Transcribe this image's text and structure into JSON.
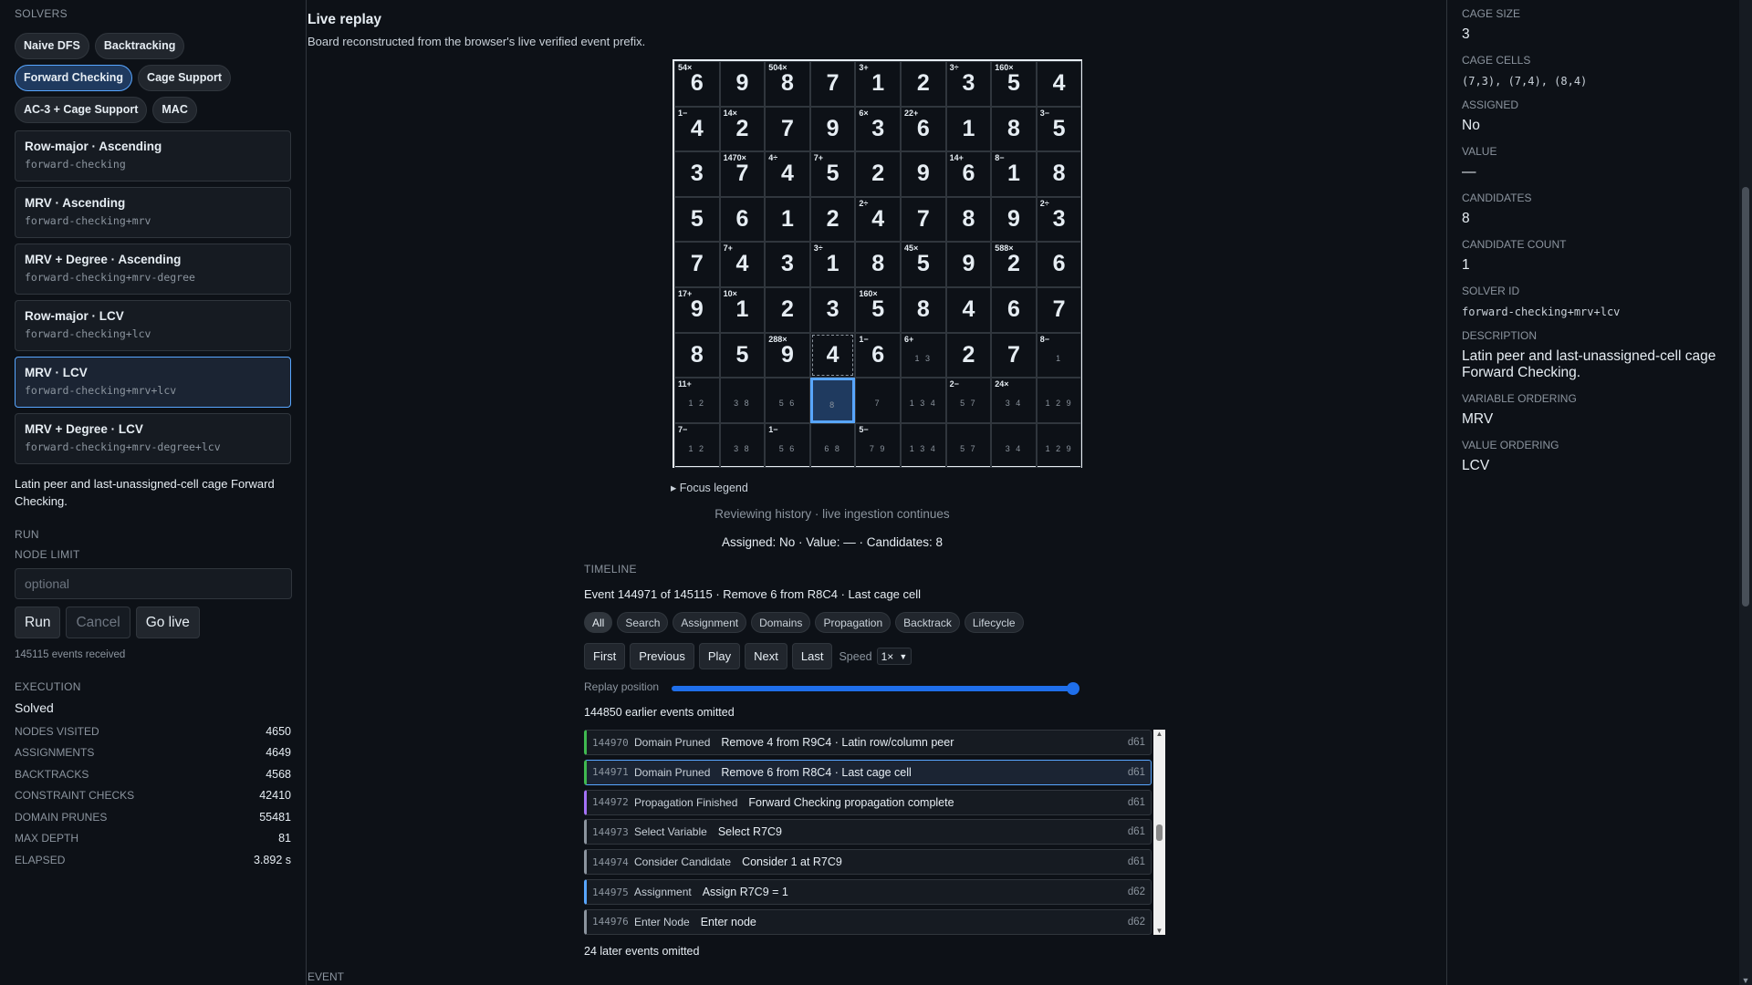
{
  "left": {
    "solvers_heading": "SOLVERS",
    "solver_pills": [
      "Naive DFS",
      "Backtracking",
      "Forward Checking",
      "Cage Support",
      "AC-3 + Cage Support",
      "MAC"
    ],
    "active_pill": "Forward Checking",
    "variants": [
      {
        "title": "Row-major · Ascending",
        "id": "forward-checking"
      },
      {
        "title": "MRV · Ascending",
        "id": "forward-checking+mrv"
      },
      {
        "title": "MRV + Degree · Ascending",
        "id": "forward-checking+mrv-degree"
      },
      {
        "title": "Row-major · LCV",
        "id": "forward-checking+lcv"
      },
      {
        "title": "MRV · LCV",
        "id": "forward-checking+mrv+lcv"
      },
      {
        "title": "MRV + Degree · LCV",
        "id": "forward-checking+mrv-degree+lcv"
      }
    ],
    "description": "Latin peer and last-unassigned-cell cage Forward Checking.",
    "run_heading": "RUN",
    "node_limit_label": "NODE LIMIT",
    "node_limit_placeholder": "optional",
    "run_label": "Run",
    "cancel_label": "Cancel",
    "golive_label": "Go live",
    "events_received": "145115 events received",
    "execution_heading": "EXECUTION",
    "execution_status": "Solved",
    "stats": [
      {
        "k": "NODES VISITED",
        "v": "4650"
      },
      {
        "k": "ASSIGNMENTS",
        "v": "4649"
      },
      {
        "k": "BACKTRACKS",
        "v": "4568"
      },
      {
        "k": "CONSTRAINT CHECKS",
        "v": "42410"
      },
      {
        "k": "DOMAIN PRUNES",
        "v": "55481"
      },
      {
        "k": "MAX DEPTH",
        "v": "81"
      },
      {
        "k": "ELAPSED",
        "v": "3.892 s"
      }
    ]
  },
  "main": {
    "title": "Live replay",
    "subtitle": "Board reconstructed from the browser's live verified event prefix.",
    "board": [
      [
        {
          "c": "54×",
          "v": "6"
        },
        {
          "v": "9"
        },
        {
          "c": "504×",
          "v": "8"
        },
        {
          "v": "7"
        },
        {
          "c": "3+",
          "v": "1"
        },
        {
          "v": "2"
        },
        {
          "c": "3÷",
          "v": "3"
        },
        {
          "c": "160×",
          "v": "5"
        },
        {
          "v": "4"
        }
      ],
      [
        {
          "c": "1−",
          "v": "4"
        },
        {
          "c": "14×",
          "v": "2"
        },
        {
          "v": "7"
        },
        {
          "v": "9"
        },
        {
          "c": "6×",
          "v": "3"
        },
        {
          "c": "22+",
          "v": "6"
        },
        {
          "v": "1"
        },
        {
          "v": "8"
        },
        {
          "c": "3−",
          "v": "5"
        }
      ],
      [
        {
          "v": "3"
        },
        {
          "c": "1470×",
          "v": "7"
        },
        {
          "c": "4÷",
          "v": "4"
        },
        {
          "c": "7+",
          "v": "5"
        },
        {
          "v": "2"
        },
        {
          "v": "9"
        },
        {
          "c": "14+",
          "v": "6"
        },
        {
          "c": "8−",
          "v": "1"
        },
        {
          "v": "8"
        }
      ],
      [
        {
          "v": "5"
        },
        {
          "v": "6"
        },
        {
          "v": "1"
        },
        {
          "v": "2"
        },
        {
          "c": "2÷",
          "v": "4"
        },
        {
          "v": "7"
        },
        {
          "v": "8"
        },
        {
          "v": "9"
        },
        {
          "c": "2÷",
          "v": "3"
        }
      ],
      [
        {
          "v": "7"
        },
        {
          "c": "7+",
          "v": "4"
        },
        {
          "v": "3"
        },
        {
          "c": "3÷",
          "v": "1"
        },
        {
          "v": "8"
        },
        {
          "c": "45×",
          "v": "5"
        },
        {
          "v": "9"
        },
        {
          "c": "588×",
          "v": "2"
        },
        {
          "v": "6"
        }
      ],
      [
        {
          "c": "17+",
          "v": "9"
        },
        {
          "c": "10×",
          "v": "1"
        },
        {
          "v": "2"
        },
        {
          "v": "3"
        },
        {
          "c": "160×",
          "v": "5"
        },
        {
          "v": "8"
        },
        {
          "v": "4"
        },
        {
          "v": "6"
        },
        {
          "v": "7"
        }
      ],
      [
        {
          "v": "8"
        },
        {
          "v": "5"
        },
        {
          "c": "288×",
          "v": "9"
        },
        {
          "v": "4",
          "rel": true
        },
        {
          "c": "1−",
          "v": "6"
        },
        {
          "c": "6+",
          "n": "1 3"
        },
        {
          "v": "2"
        },
        {
          "v": "7"
        },
        {
          "c": "8−",
          "n": "1"
        }
      ],
      [
        {
          "c": "11+",
          "n": "1 2"
        },
        {
          "n": "3 8"
        },
        {
          "n": "5 6"
        },
        {
          "n": "8",
          "sel": true
        },
        {
          "n": "7"
        },
        {
          "n": "1 3 4"
        },
        {
          "c": "2−",
          "n": "5 7"
        },
        {
          "c": "24×",
          "n": "3 4"
        },
        {
          "n": "1 2 9"
        }
      ],
      [
        {
          "c": "7−",
          "n": "1 2"
        },
        {
          "n": "3 8"
        },
        {
          "c": "1−",
          "n": "5 6"
        },
        {
          "n": "6 8"
        },
        {
          "c": "5−",
          "n": "7 9"
        },
        {
          "n": "1 3 4"
        },
        {
          "n": "5 7"
        },
        {
          "n": "3 4"
        },
        {
          "n": "1 2 9"
        }
      ]
    ],
    "focus_legend": "▸ Focus legend",
    "review_status": "Reviewing history · live ingestion continues",
    "cell_status": "Assigned: No · Value: — · Candidates: 8",
    "timeline_heading": "TIMELINE",
    "event_position": "Event 144971 of 145115 · Remove 6 from R8C4 · Last cage cell",
    "filters": [
      "All",
      "Search",
      "Assignment",
      "Domains",
      "Propagation",
      "Backtrack",
      "Lifecycle"
    ],
    "active_filter": "All",
    "controls": [
      "First",
      "Previous",
      "Play",
      "Next",
      "Last"
    ],
    "speed_label": "Speed",
    "speed_value": "1×",
    "replay_label": "Replay position",
    "replay_position": 0.999,
    "earlier_omitted": "144850 earlier events omitted",
    "events": [
      {
        "n": "144970",
        "k": "Domain Pruned",
        "m": "Remove 4 from R9C4 · Latin row/column peer",
        "d": "d61",
        "color": "#3fb950"
      },
      {
        "n": "144971",
        "k": "Domain Pruned",
        "m": "Remove 6 from R8C4 · Last cage cell",
        "d": "d61",
        "color": "#3fb950",
        "active": true
      },
      {
        "n": "144972",
        "k": "Propagation Finished",
        "m": "Forward Checking propagation complete",
        "d": "d61",
        "color": "#a371f7"
      },
      {
        "n": "144973",
        "k": "Select Variable",
        "m": "Select R7C9",
        "d": "d61",
        "color": "#8b949e"
      },
      {
        "n": "144974",
        "k": "Consider Candidate",
        "m": "Consider 1 at R7C9",
        "d": "d61",
        "color": "#8b949e"
      },
      {
        "n": "144975",
        "k": "Assignment",
        "m": "Assign R7C9 = 1",
        "d": "d62",
        "color": "#58a6ff"
      },
      {
        "n": "144976",
        "k": "Enter Node",
        "m": "Enter node",
        "d": "d62",
        "color": "#8b949e"
      }
    ],
    "later_omitted": "24 later events omitted",
    "event_heading": "EVENT"
  },
  "right": {
    "fields": [
      {
        "k": "CAGE SIZE",
        "v": "3"
      },
      {
        "k": "CAGE CELLS",
        "v": "(7,3), (7,4), (8,4)",
        "mono": true
      },
      {
        "k": "ASSIGNED",
        "v": "No"
      },
      {
        "k": "VALUE",
        "v": "—"
      },
      {
        "k": "CANDIDATES",
        "v": "8"
      },
      {
        "k": "CANDIDATE COUNT",
        "v": "1"
      },
      {
        "k": "SOLVER ID",
        "v": "forward-checking+mrv+lcv",
        "mono": true
      },
      {
        "k": "DESCRIPTION",
        "v": "Latin peer and last-unassigned-cell cage Forward Checking."
      },
      {
        "k": "VARIABLE ORDERING",
        "v": "MRV"
      },
      {
        "k": "VALUE ORDERING",
        "v": "LCV"
      }
    ]
  }
}
